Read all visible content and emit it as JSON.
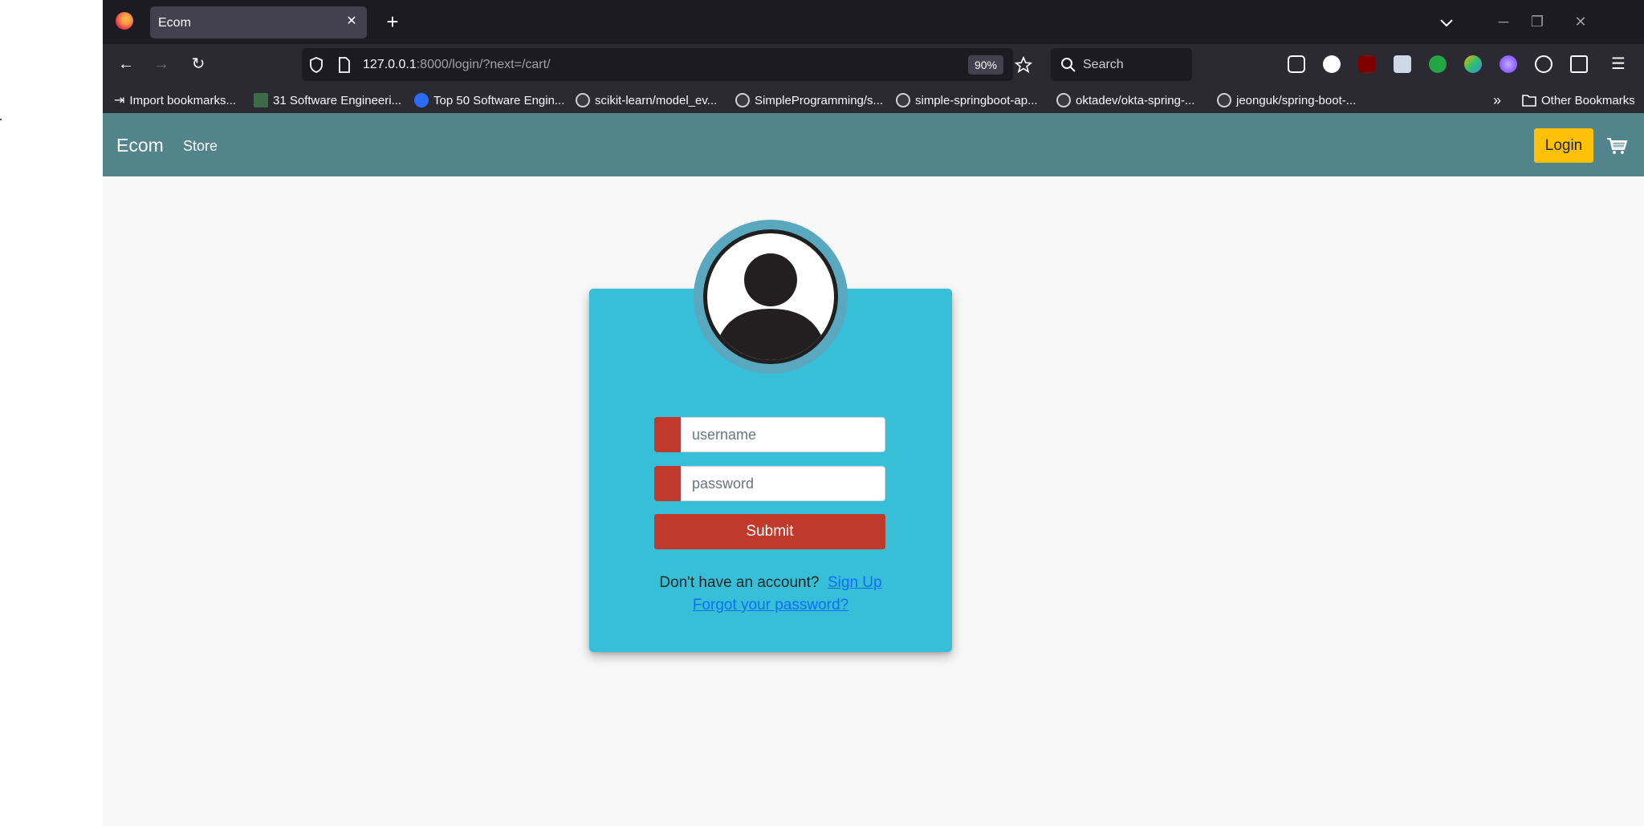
{
  "browser": {
    "tab_title": "Ecom",
    "tab_close": "✕",
    "new_tab": "+",
    "url_host": "127.0.0.1",
    "url_rest": ":8000/login/?next=/cart/",
    "zoom": "90%",
    "search_placeholder": "Search",
    "bookmarks": [
      "Import bookmarks...",
      "31 Software Engineeri...",
      "Top 50 Software Engin...",
      "scikit-learn/model_ev...",
      "SimpleProgramming/s...",
      "simple-springboot-ap...",
      "oktadev/okta-spring-...",
      "jeonguk/spring-boot-..."
    ],
    "other_bookmarks": "Other Bookmarks",
    "colors": {
      "chrome": "#1c1b22",
      "toolbar": "#2b2a33"
    }
  },
  "app": {
    "brand": "Ecom",
    "nav_store": "Store",
    "login_label": "Login",
    "colors": {
      "navbar": "#52848b",
      "login": "#ffc107",
      "card": "#36bfd6",
      "accent": "#c0392b"
    }
  },
  "form": {
    "username_placeholder": "username",
    "password_placeholder": "password",
    "submit_label": "Submit",
    "no_account_text": "Don't have an account?",
    "signup_link": "Sign Up",
    "forgot_link": "Forgot your password?"
  }
}
